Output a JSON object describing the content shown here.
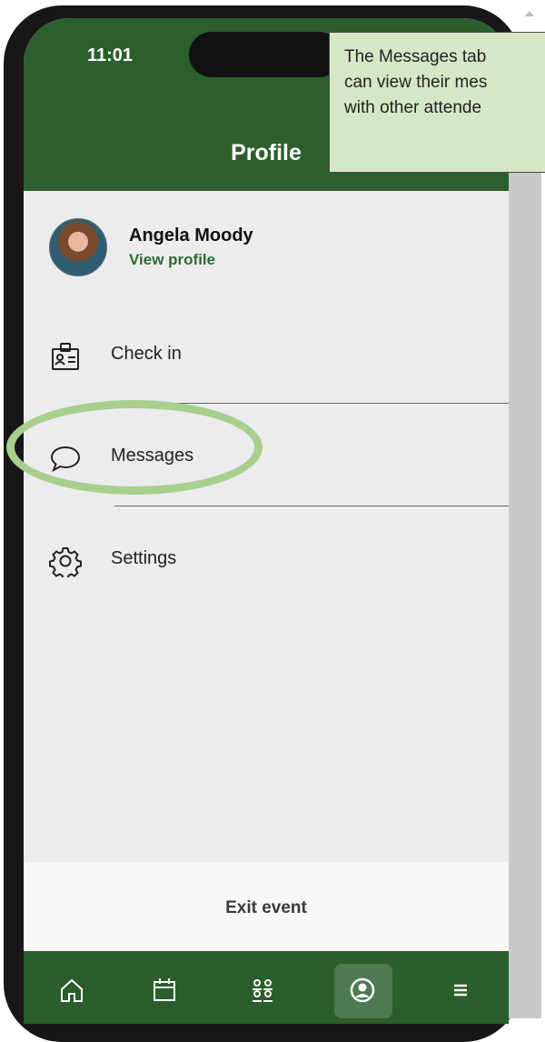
{
  "status_bar": {
    "time": "11:01"
  },
  "header": {
    "title": "Profile"
  },
  "profile": {
    "name": "Angela Moody",
    "link": "View profile"
  },
  "menu": [
    {
      "label": "Check in",
      "icon": "badge-icon"
    },
    {
      "label": "Messages",
      "icon": "chat-bubble-icon"
    },
    {
      "label": "Settings",
      "icon": "gear-icon"
    }
  ],
  "footer": {
    "exit_label": "Exit event"
  },
  "tabbar": {
    "tabs": [
      {
        "icon": "home-icon"
      },
      {
        "icon": "calendar-icon"
      },
      {
        "icon": "people-icon"
      },
      {
        "icon": "profile-icon",
        "active": true
      },
      {
        "icon": "menu-icon"
      }
    ]
  },
  "annotation": {
    "lines": [
      "The Messages tab",
      "can view their mes",
      "with other attende"
    ]
  },
  "colors": {
    "header_green": "#2c5f2d",
    "link_green": "#2e6b2f",
    "highlight_ring": "#a8cf8e",
    "callout_fill": "#d6e7c6"
  }
}
